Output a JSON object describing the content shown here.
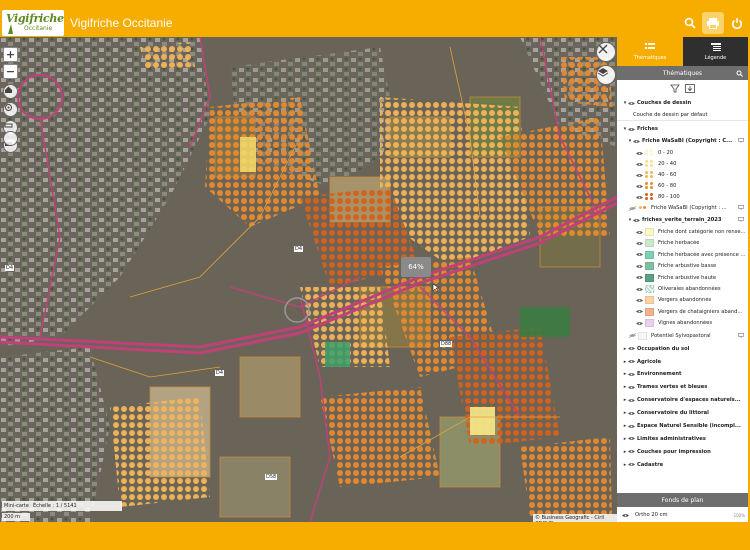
{
  "header": {
    "logo_text": "Vigifriche",
    "logo_subtext": "Occitanie",
    "title": "Vigifriche Occitanie",
    "search_icon": "search-icon",
    "print_icon": "print-icon",
    "power_icon": "power-icon"
  },
  "map": {
    "tooltip": "64%",
    "scale_text": "Échelle : 1 / 5141",
    "mini_map_label": "Mini-carte",
    "scale_distance": "200 m",
    "attribution": "© Business Geografic - Ciril GROUP",
    "road_labels": [
      "D4",
      "D4",
      "D88",
      "D4",
      "D58"
    ],
    "controls": [
      "zoom-in",
      "zoom-out",
      "zoom-extent"
    ]
  },
  "panel": {
    "tab_thematics": "Thématiques",
    "tab_legend": "Légende",
    "section_thematics": "Thématiques",
    "section_basemap": "Fonds de plan",
    "drawing_layers": "Couches de dessin",
    "drawing_default": "Couche de dessin par défaut",
    "friches_group": "Friches",
    "wasabi_layer": "Friche WaSaBI (Copyright : C...",
    "wasabi_classes": [
      {
        "label": "0 - 20",
        "color": "#fef6c9"
      },
      {
        "label": "20 - 40",
        "color": "#fbdd8a"
      },
      {
        "label": "40 - 60",
        "color": "#f4b558"
      },
      {
        "label": "60 - 80",
        "color": "#eb8d32"
      },
      {
        "label": "80 - 100",
        "color": "#d6601a"
      }
    ],
    "wasabi_layer_2": "Friche WaSaBI (Copyright : ...",
    "terrain_layer": "friches_verite_terrain_2023",
    "terrain_classes": [
      {
        "label": "Friche dont catégorie non rense...",
        "color": "#fdf7c4",
        "pattern": false
      },
      {
        "label": "Friche herbacée",
        "color": "#c9ebc9",
        "pattern": false
      },
      {
        "label": "Friche herbacée avec présence ...",
        "color": "#7dd0b0",
        "pattern": false
      },
      {
        "label": "Friche arbustive basse",
        "color": "#7fbfa0",
        "pattern": false
      },
      {
        "label": "Friche arbustive haute",
        "color": "#5aa184",
        "pattern": false
      },
      {
        "label": "Oliveraies abandonnées",
        "color": "#a8d8c8",
        "pattern": true
      },
      {
        "label": "Vergers abandonnés",
        "color": "#fbd3a2",
        "pattern": false
      },
      {
        "label": "Vergers de chataigniers aband...",
        "color": "#f3b38a",
        "pattern": false
      },
      {
        "label": "Vignes abandonnées",
        "color": "#e8d2ea",
        "pattern": false
      }
    ],
    "sylvopastoral": "Potentiel Sylvopastoral",
    "groups": [
      "Occupation du sol",
      "Agricole",
      "Environnement",
      "Trames vertes et bleues",
      "Conservatoire d'espaces naturels...",
      "Conservatoire du littoral",
      "Espace Naturel Sensible (incompl...",
      "Limites administratives",
      "Couches pour impression",
      "Cadastre"
    ],
    "basemap_layer": "Ortho 20 cm",
    "basemap_opacity": "100%"
  },
  "colors": {
    "accent": "#f7ad00",
    "dark_tab": "#2f2f2f",
    "section_bg": "#6e6e6e",
    "road": "#c2407a"
  }
}
